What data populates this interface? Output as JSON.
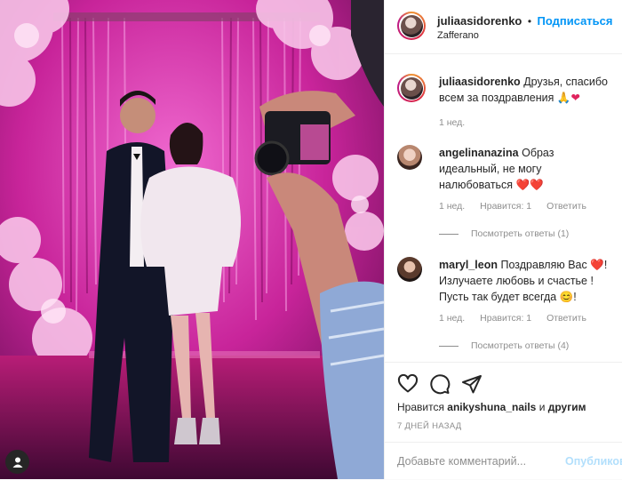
{
  "post": {
    "author": "juliaasidorenko",
    "follow_label": "Подписаться",
    "separator": "•",
    "location": "Zafferano",
    "caption_user": "juliaasidorenko",
    "caption_text": "Друзья, спасибо всем за поздравления",
    "caption_time": "1 нед."
  },
  "comments": [
    {
      "user": "angelinanazina",
      "text": "Образ идеальный, не могу налюбоваться",
      "time": "1 нед.",
      "likes": "Нравится: 1",
      "reply_label": "Ответить",
      "view_replies": "Посмотреть ответы (1)"
    },
    {
      "user": "maryl_leon",
      "text": "Поздравляю Вас",
      "text2": "Излучаете любовь и счастье ! Пусть так будет всегда",
      "time": "1 нед.",
      "likes": "Нравится: 1",
      "reply_label": "Ответить",
      "view_replies": "Посмотреть ответы (4)"
    }
  ],
  "actions": {
    "likes_prefix": "Нравится",
    "likes_user": "anikyshuna_nails",
    "likes_suffix": "и",
    "likes_others": "другим",
    "date": "7 ДНЕЙ НАЗАД"
  },
  "add_comment": {
    "placeholder": "Добавьте комментарий...",
    "publish_label": "Опубликовать"
  },
  "icons": {
    "like": "heart-icon",
    "comment": "comment-icon",
    "share": "share-icon",
    "tag": "user-tag-icon",
    "emoji_pray": "pray-emoji",
    "emoji_heart": "heart-emoji",
    "emoji_smile": "smile-emoji"
  },
  "colors": {
    "accent": "#0095f6",
    "photo_magenta": "#d2309f",
    "muted": "#8e8e8e"
  }
}
